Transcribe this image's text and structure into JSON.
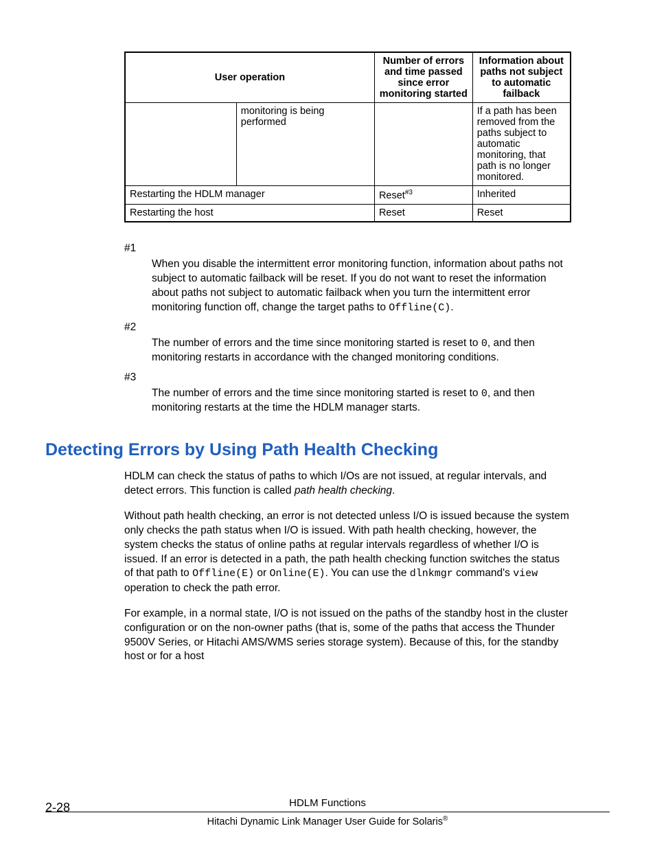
{
  "table": {
    "headers": {
      "c1": "User operation",
      "c2": "Number of errors and time passed since error monitoring started",
      "c3": "Information about paths not subject to automatic failback"
    },
    "row1": {
      "sub": "monitoring is being performed",
      "c2": "",
      "c3": "If a path has been removed from the paths subject to automatic monitoring, that path is no longer monitored."
    },
    "row2": {
      "c1": "Restarting the HDLM manager",
      "c2a": "Reset",
      "c2sup": "#3",
      "c3": "Inherited"
    },
    "row3": {
      "c1": "Restarting the host",
      "c2": "Reset",
      "c3": "Reset"
    }
  },
  "notes": {
    "n1label": "#1",
    "n1a": "When you disable the intermittent error monitoring function, information about paths not subject to automatic failback will be reset. If you do not want to reset the information about paths not subject to automatic failback when you turn the intermittent error monitoring function off, change the target paths to ",
    "n1code": "Offline(C)",
    "n1b": ".",
    "n2label": "#2",
    "n2a": "The number of errors and the time since monitoring started is reset to ",
    "n2code": "0",
    "n2b": ", and then monitoring restarts in accordance with the changed monitoring conditions.",
    "n3label": "#3",
    "n3a": "The number of errors and the time since monitoring started is reset to ",
    "n3code": "0",
    "n3b": ", and then monitoring restarts at the time the HDLM manager starts."
  },
  "section": {
    "heading": "Detecting Errors by Using Path Health Checking",
    "p1a": "HDLM can check the status of paths to which I/Os are not issued, at regular intervals, and detect errors. This function is called ",
    "p1term": "path health checking",
    "p1b": ".",
    "p2a": "Without path health checking, an error is not detected unless I/O is issued because the system only checks the path status when I/O is issued. With path health checking, however, the system checks the status of online paths at regular intervals regardless of whether I/O is issued. If an error is detected in a path, the path health checking function switches the status of that path to ",
    "p2code1": "Offline(E)",
    "p2mid1": " or ",
    "p2code2": "Online(E)",
    "p2mid2": ". You can use the ",
    "p2code3": "dlnkmgr",
    "p2mid3": " command's ",
    "p2code4": "view",
    "p2end": " operation to check the path error.",
    "p3": "For example, in a normal state, I/O is not issued on the paths of the standby host in the cluster configuration or on the non-owner paths (that is, some of the paths that access the Thunder 9500V Series, or Hitachi AMS/WMS series storage system). Because of this, for the standby host or for a host"
  },
  "footer": {
    "pagenum": "2-28",
    "line1": "HDLM Functions",
    "line2a": "Hitachi Dynamic Link Manager User Guide for Solaris",
    "line2sup": "®"
  }
}
